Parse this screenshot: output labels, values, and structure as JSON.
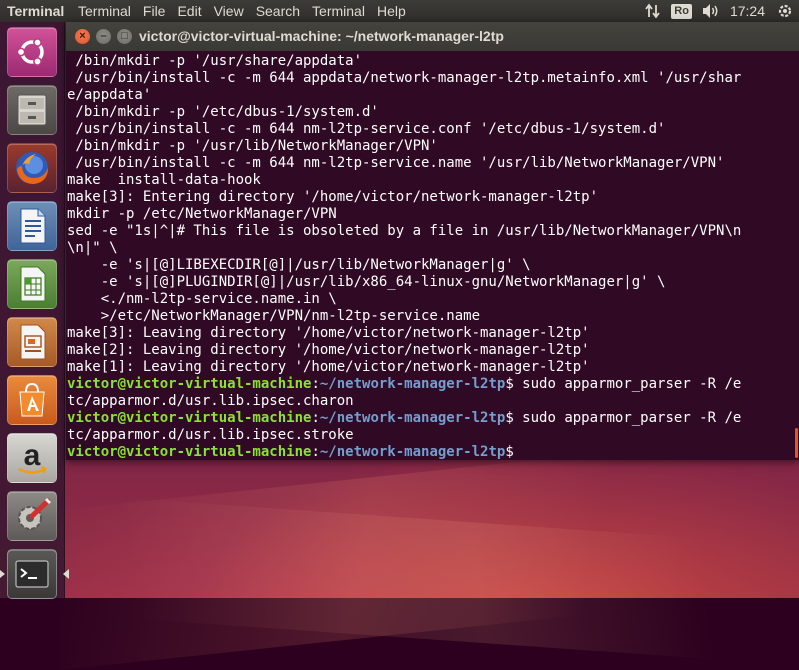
{
  "top_panel": {
    "app_title": "Terminal",
    "menu": [
      "Terminal",
      "File",
      "Edit",
      "View",
      "Search",
      "Terminal",
      "Help"
    ],
    "keyboard_layout": "Ro",
    "clock": "17:24"
  },
  "window": {
    "title": "victor@victor-virtual-machine: ~/network-manager-l2tp",
    "close_glyph": "×",
    "minimize_glyph": "–",
    "maximize_glyph": "□"
  },
  "terminal": {
    "output_lines": [
      " /bin/mkdir -p '/usr/share/appdata'",
      " /usr/bin/install -c -m 644 appdata/network-manager-l2tp.metainfo.xml '/usr/shar",
      "e/appdata'",
      " /bin/mkdir -p '/etc/dbus-1/system.d'",
      " /usr/bin/install -c -m 644 nm-l2tp-service.conf '/etc/dbus-1/system.d'",
      " /bin/mkdir -p '/usr/lib/NetworkManager/VPN'",
      " /usr/bin/install -c -m 644 nm-l2tp-service.name '/usr/lib/NetworkManager/VPN'",
      "make  install-data-hook",
      "make[3]: Entering directory '/home/victor/network-manager-l2tp'",
      "mkdir -p /etc/NetworkManager/VPN",
      "sed -e \"1s|^|# This file is obsoleted by a file in /usr/lib/NetworkManager/VPN\\n",
      "\\n|\" \\",
      "    -e 's|[@]LIBEXECDIR[@]|/usr/lib/NetworkManager|g' \\",
      "    -e 's|[@]PLUGINDIR[@]|/usr/lib/x86_64-linux-gnu/NetworkManager|g' \\",
      "    <./nm-l2tp-service.name.in \\",
      "    >/etc/NetworkManager/VPN/nm-l2tp-service.name",
      "make[3]: Leaving directory '/home/victor/network-manager-l2tp'",
      "make[2]: Leaving directory '/home/victor/network-manager-l2tp'",
      "make[1]: Leaving directory '/home/victor/network-manager-l2tp'"
    ],
    "prompt_user": "victor@victor-virtual-machine",
    "prompt_path": "~/network-manager-l2tp",
    "command1_a": " sudo apparmor_parser -R /e",
    "command1_b": "tc/apparmor.d/usr.lib.ipsec.charon",
    "command2_a": " sudo apparmor_parser -R /e",
    "command2_b": "tc/apparmor.d/usr.lib.ipsec.stroke"
  },
  "launcher": {
    "items": [
      "ubuntu-dash",
      "files",
      "firefox",
      "libreoffice-writer",
      "libreoffice-calc",
      "libreoffice-impress",
      "ubuntu-software",
      "amazon",
      "system-settings",
      "terminal"
    ]
  }
}
